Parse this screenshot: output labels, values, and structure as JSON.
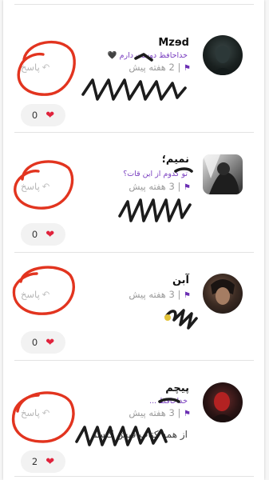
{
  "comments": [
    {
      "username": "Mzɘd",
      "subtitle": "خداحافظ دوست دارم 🖤",
      "time": "2 هفته پیش",
      "reply_label": "پاسخ",
      "likes": "0"
    },
    {
      "username": "نمیم؛",
      "subtitle": "تو کدوم از این قات؟",
      "time": "3 هفته پیش",
      "reply_label": "پاسخ",
      "likes": "0"
    },
    {
      "username": "آبن",
      "subtitle": "",
      "time": "3 هفته پیش",
      "reply_label": "پاسخ",
      "likes": "0"
    },
    {
      "username": "پیچم",
      "subtitle": "خداحافظ ...",
      "time": "3 هفته پیش",
      "reply_label": "پاسخ",
      "likes": "2",
      "body": "از همه کتاب فیش کنسم"
    }
  ],
  "colors": {
    "accent": "#7a3fc0",
    "annotation_red": "#e2341f",
    "scribble": "#1c1c1c",
    "like_heart": "#e0233c"
  },
  "icons": [
    "reply-arrow-icon",
    "flag-icon",
    "heart-icon"
  ]
}
